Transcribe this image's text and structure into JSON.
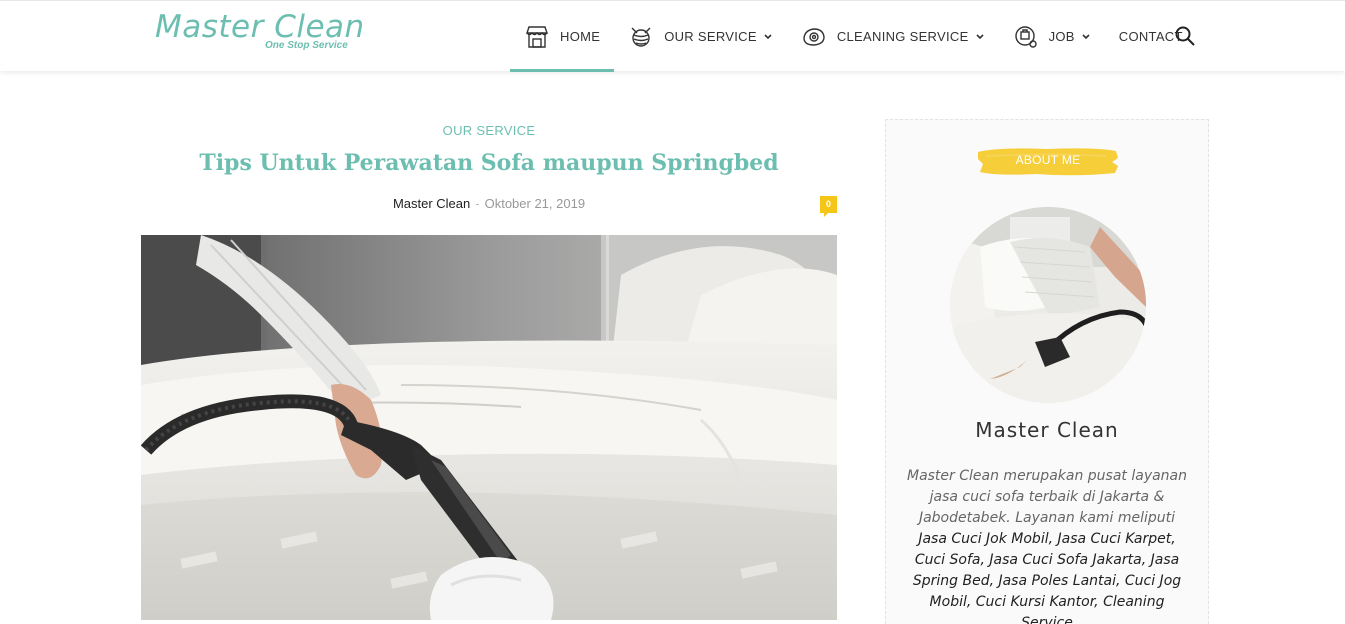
{
  "site": {
    "logo_main": "Master Clean",
    "logo_sub": "One Stop Service"
  },
  "nav": {
    "items": [
      {
        "label": "HOME",
        "icon": "shop-icon"
      },
      {
        "label": "OUR SERVICE",
        "icon": "yarn-icon"
      },
      {
        "label": "CLEANING SERVICE",
        "icon": "iron-icon"
      },
      {
        "label": "JOB",
        "icon": "job-icon"
      },
      {
        "label": "CONTACT"
      }
    ],
    "search_icon": "search-icon"
  },
  "article": {
    "category": "OUR SERVICE",
    "title": "Tips Untuk Perawatan Sofa maupun Springbed",
    "author": "Master Clean",
    "separator": "-",
    "date": "Oktober 21, 2019",
    "comment_count": "0"
  },
  "sidebar": {
    "badge": "ABOUT ME",
    "name": "Master Clean",
    "text_plain": "Master Clean merupakan pusat layanan jasa cuci sofa terbaik di Jakarta & Jabodetabek. Layanan kami meliputi ",
    "text_links": "Jasa Cuci Jok Mobil, Jasa Cuci Karpet, Cuci Sofa, Jasa Cuci Sofa Jakarta, Jasa Spring Bed, Jasa Poles Lantai, Cuci Jog Mobil, Cuci Kursi Kantor, Cleaning Service"
  },
  "colors": {
    "accent": "#6cbfb0",
    "badge_yellow": "#f5c518"
  }
}
